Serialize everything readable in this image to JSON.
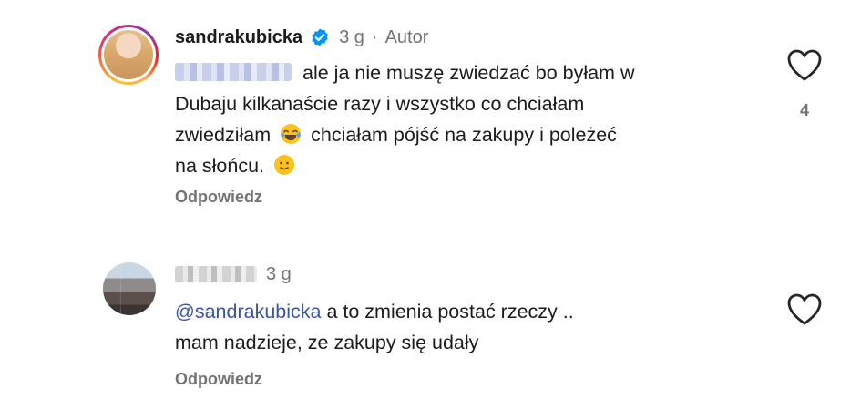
{
  "comments": [
    {
      "username": "sandrakubicka",
      "verified": true,
      "time": "3 g",
      "separator": "·",
      "author_badge": "Autor",
      "text_line1": "ale ja nie muszę zwiedzać bo byłam w",
      "text_line2": "Dubaju kilkanaście razy i wszystko co chciałam",
      "text_line3a": "zwiedziłam",
      "text_line3b": "chciałam pójść na zakupy i poleżeć",
      "text_line4": "na słońcu.",
      "emoji1": "face-with-tears-of-joy-icon",
      "emoji2": "slightly-smiling-face-icon",
      "reply_label": "Odpowiedz",
      "like_count": "4"
    },
    {
      "time": "3 g",
      "mention": "@sandrakubicka",
      "text_line1": "a to zmienia postać rzeczy ..",
      "text_line2": "mam nadzieje, ze zakupy się udały",
      "reply_label": "Odpowiedz"
    }
  ],
  "colors": {
    "mention": "#3b55a5",
    "secondary_text": "#737373",
    "verified_badge": "#0095f6"
  }
}
